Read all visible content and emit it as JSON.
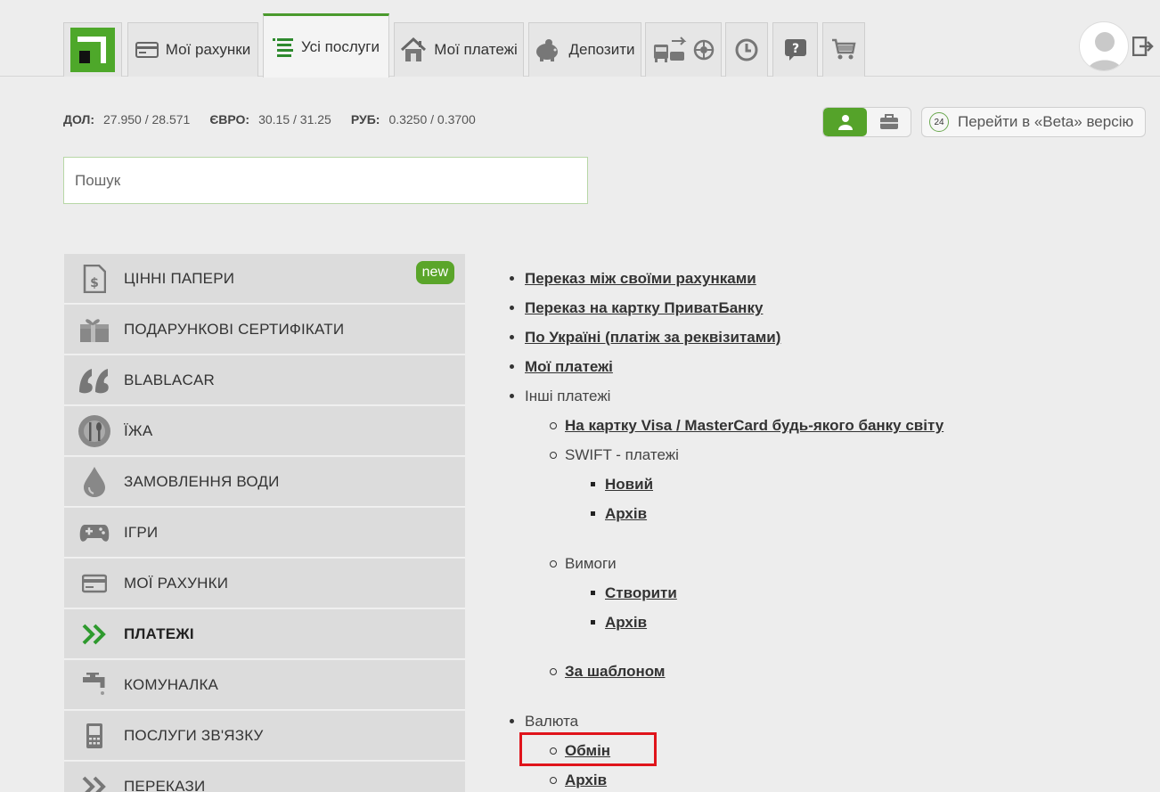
{
  "tabs": {
    "accounts": "Мої рахунки",
    "all_services": "Усі послуги",
    "my_payments": "Мої платежі",
    "deposits": "Депозити"
  },
  "rates": {
    "usd_label": "ДОЛ:",
    "usd_value": "27.950 / 28.571",
    "eur_label": "ЄВРО:",
    "eur_value": "30.15 / 31.25",
    "rub_label": "РУБ:",
    "rub_value": "0.3250 / 0.3700"
  },
  "beta": {
    "badge": "24",
    "label": "Перейти в «Beta» версію"
  },
  "search": {
    "placeholder": "Пошук"
  },
  "sidebar": {
    "items": [
      {
        "label": "ЦІННІ ПАПЕРИ",
        "icon": "securities-icon",
        "badge": "new"
      },
      {
        "label": "ПОДАРУНКОВІ СЕРТИФІКАТИ",
        "icon": "gift-icon"
      },
      {
        "label": "BLABLACAR",
        "icon": "blablacar-icon"
      },
      {
        "label": "ЇЖА",
        "icon": "food-icon"
      },
      {
        "label": "ЗАМОВЛЕННЯ ВОДИ",
        "icon": "water-drop-icon"
      },
      {
        "label": "ІГРИ",
        "icon": "gamepad-icon"
      },
      {
        "label": "МОЇ РАХУНКИ",
        "icon": "card-icon"
      },
      {
        "label": "ПЛАТЕЖІ",
        "icon": "double-chevron-icon",
        "active": true
      },
      {
        "label": "КОМУНАЛКА",
        "icon": "faucet-icon"
      },
      {
        "label": "ПОСЛУГИ ЗВ'ЯЗКУ",
        "icon": "phone-icon"
      },
      {
        "label": "ПЕРЕКАЗИ",
        "icon": "transfer-chevron-icon"
      }
    ]
  },
  "content": {
    "transfer_own": "Переказ між своїми рахунками",
    "transfer_privat": "Переказ на картку ПриватБанку",
    "ukraine": "По Україні (платіж за реквізитами)",
    "my_payments": "Мої платежі",
    "other_payments": "Інші платежі",
    "visa_mc": "На картку Visa / MasterCard будь-якого банку світу",
    "swift": "SWIFT - платежі",
    "swift_new": "Новий",
    "swift_archive": "Архів",
    "demands": "Вимоги",
    "demands_create": "Створити",
    "demands_archive": "Архів",
    "by_template": "За шаблоном",
    "currency": "Валюта",
    "exchange": "Обмін",
    "currency_archive": "Архів"
  },
  "colors": {
    "accent": "#4ea82a",
    "highlight": "#e0141b"
  }
}
